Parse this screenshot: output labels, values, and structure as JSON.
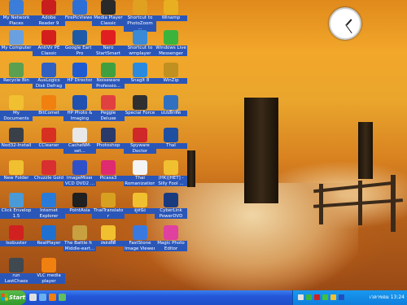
{
  "colors": {
    "label_bg": "#2a56b8",
    "taskbar": "#2357d8",
    "start_green": "#2f9a2a",
    "tray_bg": "#0f7fdc"
  },
  "desktop_icons": [
    {
      "label": "My Network Places",
      "icon": "network-icon",
      "color": "#3b7dd8"
    },
    {
      "label": "Adobe Reader 9",
      "icon": "pdf-icon",
      "color": "#c81e1e"
    },
    {
      "label": "FirePicViewer",
      "icon": "picture-viewer-icon",
      "color": "#2e6fd6"
    },
    {
      "label": "Media Player Classic",
      "icon": "media-player-icon",
      "color": "#2a2a2a"
    },
    {
      "label": "Shortcut to PhotoZoom ...",
      "icon": "photozoom-icon",
      "color": "#e0a020"
    },
    {
      "label": "Winamp",
      "icon": "winamp-icon",
      "color": "#e8b020"
    },
    {
      "label": "My Computer",
      "icon": "computer-icon",
      "color": "#6aa0e0"
    },
    {
      "label": "AntiVir PE Classic",
      "icon": "antivir-icon",
      "color": "#d41e1e"
    },
    {
      "label": "Google Earth Pro",
      "icon": "globe-icon",
      "color": "#1f5aa8"
    },
    {
      "label": "Nero StartSmart",
      "icon": "nero-icon",
      "color": "#e02020"
    },
    {
      "label": "Shortcut to wmplayer",
      "icon": "wmplayer-icon",
      "color": "#3a8ad8"
    },
    {
      "label": "Windows Live Messenger",
      "icon": "messenger-icon",
      "color": "#3cb43c"
    },
    {
      "label": "Recycle Bin",
      "icon": "recycle-bin-icon",
      "color": "#5aa050"
    },
    {
      "label": "AusLogics Disk Defrag",
      "icon": "defrag-icon",
      "color": "#3060c0"
    },
    {
      "label": "HP Director",
      "icon": "hp-icon",
      "color": "#1e5bd0"
    },
    {
      "label": "Noiseware Professio...",
      "icon": "noiseware-icon",
      "color": "#40a040"
    },
    {
      "label": "SnagIt 8",
      "icon": "snagit-icon",
      "color": "#2a8ae0"
    },
    {
      "label": "WinZip",
      "icon": "winzip-icon",
      "color": "#c09020"
    },
    {
      "label": "My Documents",
      "icon": "documents-folder-icon",
      "color": "#f0c030"
    },
    {
      "label": "BitComet",
      "icon": "bitcomet-icon",
      "color": "#f08010"
    },
    {
      "label": "HP Photo & Imaging",
      "icon": "hp-photo-icon",
      "color": "#2050b0"
    },
    {
      "label": "Peggle Deluxe",
      "icon": "peggle-icon",
      "color": "#e04040"
    },
    {
      "label": "Special Force",
      "icon": "game-icon",
      "color": "#303030"
    },
    {
      "label": "แบบฝึกหัด",
      "icon": "runner-icon",
      "color": "#3070c0"
    },
    {
      "label": "Nod32-Install",
      "icon": "nod32-icon",
      "color": "#3a4048"
    },
    {
      "label": "CCleaner",
      "icon": "ccleaner-icon",
      "color": "#d83020"
    },
    {
      "label": "CacheNM-set...",
      "icon": "cache-icon",
      "color": "#e8e8e8"
    },
    {
      "label": "Photoshop",
      "icon": "photoshop-icon",
      "color": "#2a3a6a"
    },
    {
      "label": "Spyware Doctor",
      "icon": "spyware-doctor-icon",
      "color": "#d02828"
    },
    {
      "label": "ThaI",
      "icon": "thai-icon",
      "color": "#1e4fa0"
    },
    {
      "label": "New Folder",
      "icon": "folder-icon",
      "color": "#f0c030"
    },
    {
      "label": "Chuzzle Gold",
      "icon": "chuzzle-icon",
      "color": "#d83030"
    },
    {
      "label": "ImageMixer VCD DVD2 ...",
      "icon": "imagemixer-icon",
      "color": "#3050c8"
    },
    {
      "label": "Picasa3",
      "icon": "picasa-icon",
      "color": "#e02a70"
    },
    {
      "label": "Thai Romanization",
      "icon": "document-icon",
      "color": "#f4f4f4"
    },
    {
      "label": "(HK)[HET] - Silly Fool ...",
      "icon": "folder-icon",
      "color": "#f0c030"
    },
    {
      "label": "Click Envelop 1.5",
      "icon": "envelope-icon",
      "color": "#4a9ad8"
    },
    {
      "label": "Internet Explorer",
      "icon": "ie-icon",
      "color": "#2a7ad8"
    },
    {
      "label": "PointAsia",
      "icon": "pointasia-icon",
      "color": "#202020"
    },
    {
      "label": "ThaiTranslator",
      "icon": "translator-icon",
      "color": "#d8a020"
    },
    {
      "label": "ดูหนัง",
      "icon": "folder-icon",
      "color": "#f0c030"
    },
    {
      "label": "CyberLink PowerDVD",
      "icon": "powerdvd-icon",
      "color": "#1a3a80"
    },
    {
      "label": "Isobuster",
      "icon": "isobuster-icon",
      "color": "#d02020"
    },
    {
      "label": "RealPlayer",
      "icon": "realplayer-icon",
      "color": "#2070d0"
    },
    {
      "label": "The Battle for Middle-eart...",
      "icon": "battle-icon",
      "color": "#c8a040"
    },
    {
      "label": "เพลงดีดี",
      "icon": "folder-icon",
      "color": "#f0c030"
    },
    {
      "label": "FastStone Image Viewer",
      "icon": "faststone-icon",
      "color": "#3a7ae0"
    },
    {
      "label": "Magic Photo Editor",
      "icon": "magic-photo-icon",
      "color": "#e040a0"
    },
    {
      "label": "run LastChaos",
      "icon": "lastchaos-icon",
      "color": "#404850"
    },
    {
      "label": "VLC media player",
      "icon": "vlc-icon",
      "color": "#f08010"
    }
  ],
  "taskbar": {
    "start_label": "Start",
    "quick_launch": [
      {
        "icon": "show-desktop-icon",
        "color": "#e0e0e0"
      },
      {
        "icon": "ie-quick-icon",
        "color": "#6ab0f0"
      },
      {
        "icon": "media-quick-icon",
        "color": "#f08010"
      },
      {
        "icon": "messenger-quick-icon",
        "color": "#60c060"
      }
    ],
    "tray_icons": [
      {
        "icon": "tray-volume-icon",
        "color": "#e0e0e0"
      },
      {
        "icon": "tray-network-icon",
        "color": "#3cb43c"
      },
      {
        "icon": "tray-antivirus-icon",
        "color": "#d02020"
      },
      {
        "icon": "tray-messenger-icon",
        "color": "#40c040"
      },
      {
        "icon": "tray-update-icon",
        "color": "#f0c030"
      },
      {
        "icon": "tray-language-icon",
        "color": "#2050c0"
      }
    ],
    "clock_text": "เวลาขอม 13:24"
  },
  "clock_gadget": {
    "hours": 13,
    "minutes": 24
  }
}
